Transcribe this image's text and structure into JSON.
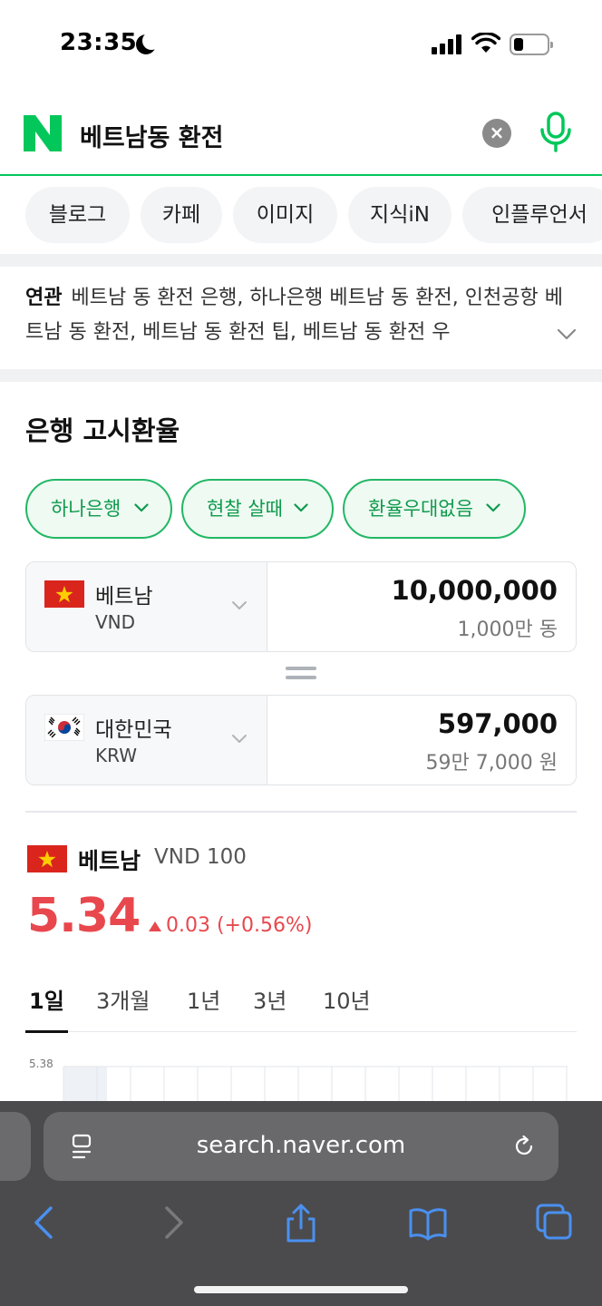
{
  "status_bar": {
    "time": "23:35",
    "icons": [
      "moon-icon",
      "cellular-signal-icon",
      "wifi-icon",
      "battery-icon"
    ]
  },
  "search": {
    "query": "베트남동 환전",
    "logo": "N",
    "brand_color": "#03c75a"
  },
  "tabs": [
    "블로그",
    "카페",
    "이미지",
    "지식iN",
    "인플루언서"
  ],
  "related": {
    "label": "연관",
    "text": "베트남 동 환전 은행, 하나은행 베트남 동 환전, 인천공항 베트남 동 환전, 베트남 동 환전 팁, 베트남 동 환전 우"
  },
  "exchange": {
    "title": "은행 고시환율",
    "filters": [
      "하나은행",
      "현찰 살때",
      "환율우대없음"
    ],
    "from": {
      "country": "베트남",
      "code": "VND",
      "amount": "10,000,000",
      "amount_readable": "1,000만 동"
    },
    "to": {
      "country": "대한민국",
      "code": "KRW",
      "amount": "597,000",
      "amount_readable": "59만 7,000 원"
    }
  },
  "rate": {
    "country": "베트남",
    "unit": "VND 100",
    "value": "5.34",
    "change": "0.03 (+0.56%)",
    "direction": "up",
    "color": "#e8484d"
  },
  "periods": [
    "1일",
    "3개월",
    "1년",
    "3년",
    "10년"
  ],
  "active_period": "1일",
  "chart_data": {
    "type": "line",
    "y_tick_labels": [
      "5.38"
    ],
    "grid": true,
    "highlight_color": "#eef1f6"
  },
  "browser": {
    "url": "search.naver.com",
    "toolbar_icons": [
      "back-icon",
      "forward-icon",
      "share-icon",
      "bookmarks-icon",
      "tabs-icon"
    ]
  }
}
